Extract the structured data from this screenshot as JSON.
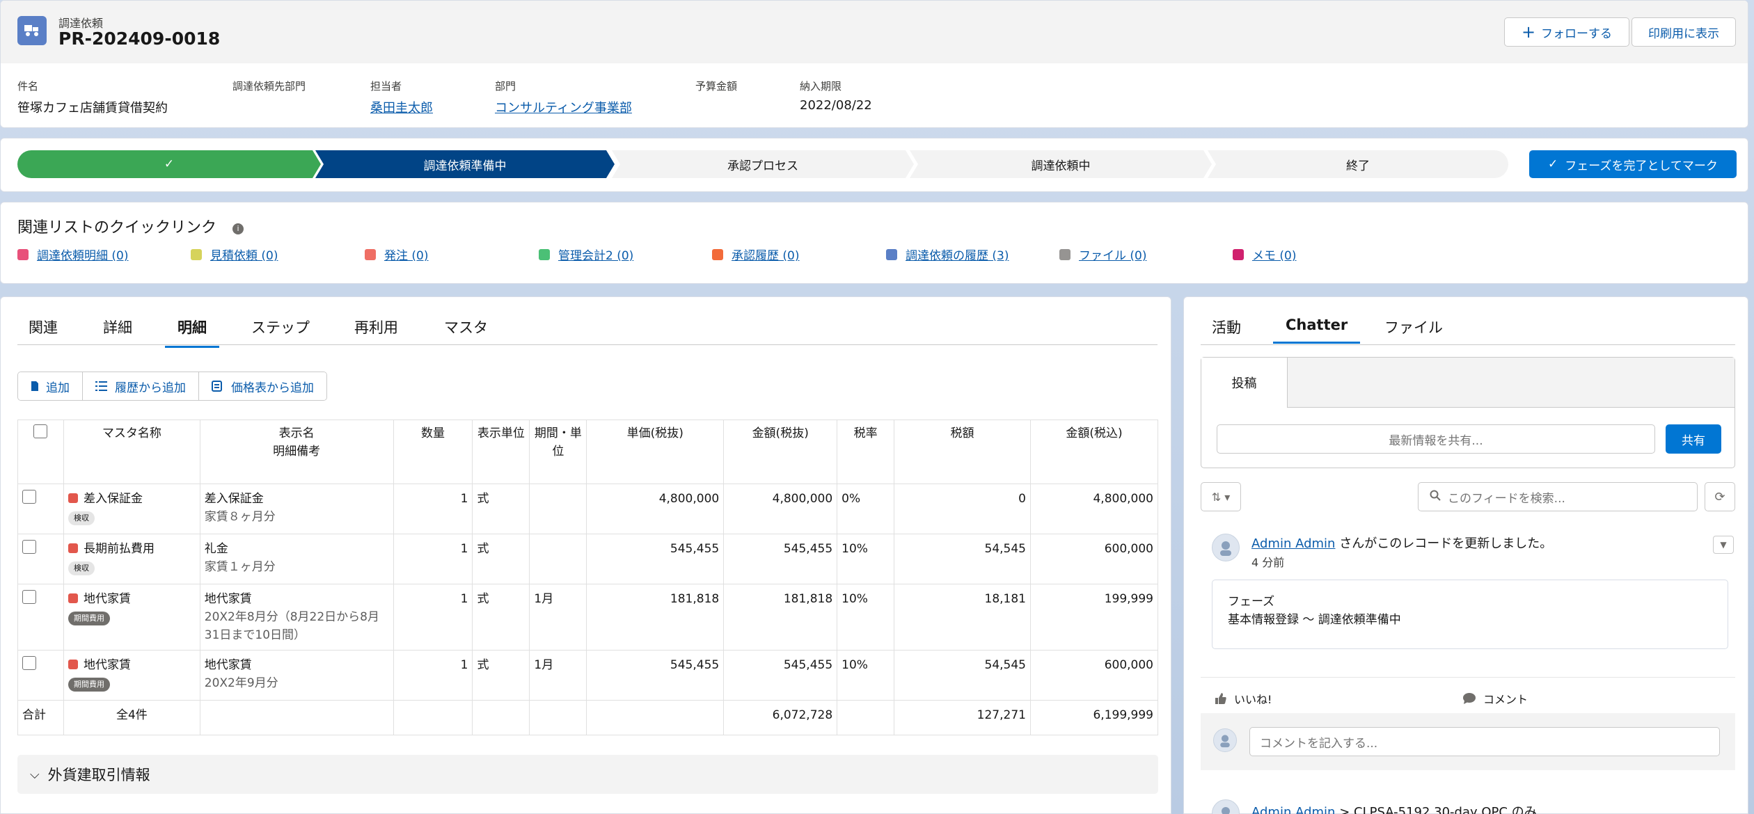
{
  "header": {
    "object_label": "調達依頼",
    "record_title": "PR-202409-0018",
    "follow_label": "フォローする",
    "print_label": "印刷用に表示",
    "fields": [
      {
        "label": "件名",
        "value": "笹塚カフェ店舗賃貸借契約"
      },
      {
        "label": "調達依頼先部門",
        "value": ""
      },
      {
        "label": "担当者",
        "value": "桑田圭太郎"
      },
      {
        "label": "部門",
        "value": "コンサルティング事業部"
      },
      {
        "label": "予算金額",
        "value": ""
      },
      {
        "label": "納入期限",
        "value": "2022/08/22"
      }
    ]
  },
  "path": {
    "steps": [
      {
        "label": "",
        "state": "complete"
      },
      {
        "label": "調達依頼準備中",
        "state": "current"
      },
      {
        "label": "承認プロセス",
        "state": "incomplete"
      },
      {
        "label": "調達依頼中",
        "state": "incomplete"
      },
      {
        "label": "終了",
        "state": "incomplete"
      }
    ],
    "mark_complete_label": "フェーズを完了としてマーク",
    "colors": {
      "complete": "#3ba755",
      "current": "#014486",
      "incomplete": "#f3f3f3"
    }
  },
  "quick_links": {
    "title": "関連リストのクイックリンク",
    "items": [
      {
        "label": "調達依頼明細 (0)",
        "icon": "line-items-icon",
        "color": "#e8517a"
      },
      {
        "label": "見積依頼 (0)",
        "icon": "quote-icon",
        "color": "#d6d35b"
      },
      {
        "label": "発注 (0)",
        "icon": "order-icon",
        "color": "#ef6e64"
      },
      {
        "label": "管理会計2 (0)",
        "icon": "accounting-icon",
        "color": "#4bc076"
      },
      {
        "label": "承認履歴 (0)",
        "icon": "approval-icon",
        "color": "#f26b3a"
      },
      {
        "label": "調達依頼の履歴 (3)",
        "icon": "history-icon",
        "color": "#5a7fc6"
      },
      {
        "label": "ファイル (0)",
        "icon": "file-icon",
        "color": "#969492"
      },
      {
        "label": "メモ (0)",
        "icon": "note-icon",
        "color": "#d0216e"
      }
    ]
  },
  "main": {
    "tabs": [
      "関連",
      "詳細",
      "明細",
      "ステップ",
      "再利用",
      "マスタ"
    ],
    "active_tab": "明細",
    "buttons": [
      "追加",
      "履歴から追加",
      "価格表から追加"
    ],
    "table": {
      "headers": {
        "master": "マスタ名称",
        "display_name": "表示名",
        "display_note": "明細備考",
        "qty": "数量",
        "unit": "表示単位",
        "period": "期間・単位",
        "unit_price": "単価(税抜)",
        "amount": "金額(税抜)",
        "tax_rate": "税率",
        "tax": "税額",
        "amount_incl": "金額(税込)"
      },
      "rows": [
        {
          "master": "差入保証金",
          "badge": "検収",
          "badge_dark": false,
          "display": "差入保証金",
          "note": "家賃８ヶ月分",
          "qty": "1",
          "unit": "式",
          "period": "",
          "unit_price": "4,800,000",
          "amount": "4,800,000",
          "tax_rate": "0%",
          "tax": "0",
          "amount_incl": "4,800,000"
        },
        {
          "master": "長期前払費用",
          "badge": "検収",
          "badge_dark": false,
          "display": "礼金",
          "note": "家賃１ヶ月分",
          "qty": "1",
          "unit": "式",
          "period": "",
          "unit_price": "545,455",
          "amount": "545,455",
          "tax_rate": "10%",
          "tax": "54,545",
          "amount_incl": "600,000"
        },
        {
          "master": "地代家賃",
          "badge": "期間費用",
          "badge_dark": true,
          "display": "地代家賃",
          "note": "20X2年8月分（8月22日から8月31日まで10日間）",
          "qty": "1",
          "unit": "式",
          "period": "1月",
          "unit_price": "181,818",
          "amount": "181,818",
          "tax_rate": "10%",
          "tax": "18,181",
          "amount_incl": "199,999"
        },
        {
          "master": "地代家賃",
          "badge": "期間費用",
          "badge_dark": true,
          "display": "地代家賃",
          "note": "20X2年9月分",
          "qty": "1",
          "unit": "式",
          "period": "1月",
          "unit_price": "545,455",
          "amount": "545,455",
          "tax_rate": "10%",
          "tax": "54,545",
          "amount_incl": "600,000"
        }
      ],
      "total": {
        "label": "合計",
        "count": "全4件",
        "amount": "6,072,728",
        "tax": "127,271",
        "amount_incl": "6,199,999"
      }
    },
    "section_fx": "外貨建取引情報"
  },
  "side": {
    "tabs": [
      "活動",
      "Chatter",
      "ファイル"
    ],
    "active_tab": "Chatter",
    "publisher_tab": "投稿",
    "share_placeholder": "最新情報を共有...",
    "share_label": "共有",
    "search_placeholder": "このフィードを検索...",
    "post": {
      "author": "Admin Admin",
      "action": " さんがこのレコードを更新しました。",
      "time": "4 分前",
      "field_label": "フェーズ",
      "change": "基本情報登録 〜 調達依頼準備中"
    },
    "like_label": "いいね!",
    "comment_label": "コメント",
    "comment_placeholder": "コメントを記入する...",
    "next_post_author": "Admin Admin",
    "next_post_text": " > CLPSA-5192 30-day OPC のみ"
  }
}
